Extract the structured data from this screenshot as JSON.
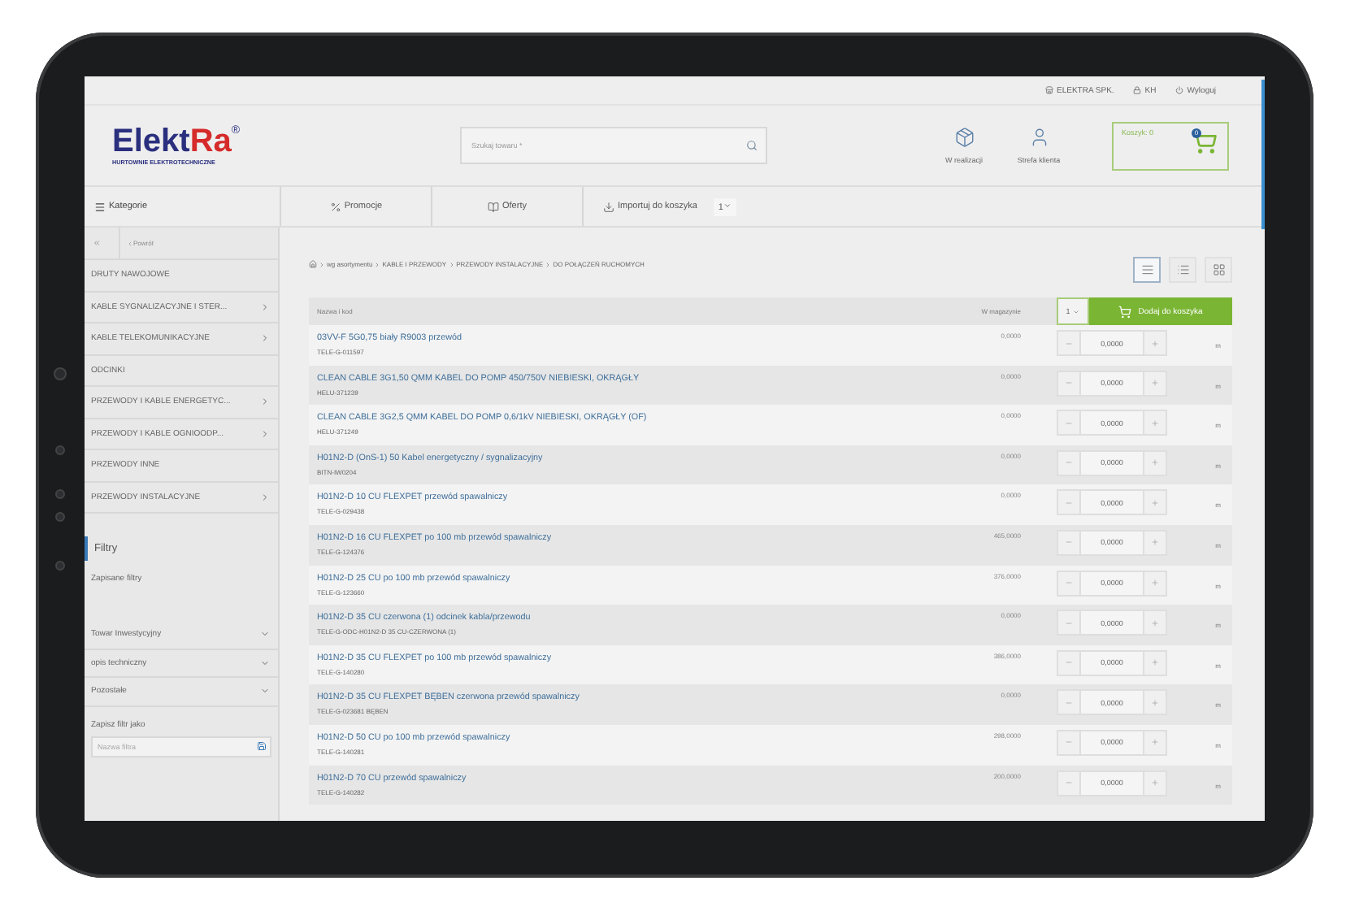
{
  "top_links": [
    {
      "kind": "store",
      "label": "ELEKTRA SPK."
    },
    {
      "kind": "lock",
      "label": "KH"
    },
    {
      "kind": "power",
      "label": "Wyloguj"
    }
  ],
  "logo": {
    "primary": "Elekt",
    "accent": "Ra",
    "mark": "®",
    "tagline": "HURTOWNIE ELEKTROTECHNICZNE"
  },
  "search": {
    "placeholder": "Szukaj towaru *"
  },
  "header_actions": [
    {
      "kind": "box",
      "label": "W realizacji"
    },
    {
      "kind": "user",
      "label": "Strefa klienta"
    }
  ],
  "cart": {
    "label": "Koszyk: 0",
    "count": "0"
  },
  "categories_button": {
    "label": "Kategorie"
  },
  "nav_tabs": [
    {
      "kind": "percent",
      "label": "Promocje"
    },
    {
      "kind": "book",
      "label": "Oferty"
    },
    {
      "kind": "import",
      "label": "Importuj do koszyka",
      "value": "1"
    }
  ],
  "sidebar": {
    "back_label": "Powrót",
    "items": [
      {
        "label": "DRUTY NAWOJOWE",
        "has_children": false
      },
      {
        "label": "KABLE SYGNALIZACYJNE I STER...",
        "has_children": true
      },
      {
        "label": "KABLE TELEKOMUNIKACYJNE",
        "has_children": true
      },
      {
        "label": "ODCINKI",
        "has_children": false
      },
      {
        "label": "PRZEWODY I KABLE ENERGETYC...",
        "has_children": true
      },
      {
        "label": "PRZEWODY I KABLE OGNIOODP...",
        "has_children": true
      },
      {
        "label": "PRZEWODY INNE",
        "has_children": false
      },
      {
        "label": "PRZEWODY INSTALACYJNE",
        "has_children": true
      }
    ],
    "filters": {
      "title": "Filtry",
      "saved_label": "Zapisane filtry",
      "dropdowns": [
        "Towar Inwestycyjny",
        "opis techniczny",
        "Pozostałe"
      ],
      "save_label": "Zapisz filtr jako",
      "name_placeholder": "Nazwa filtra"
    }
  },
  "breadcrumb": [
    "wg asortymentu",
    "KABLE I PRZEWODY",
    "PRZEWODY INSTALACYJNE",
    "DO POŁĄCZEŃ RUCHOMYCH"
  ],
  "view_modes": [
    {
      "kind": "list",
      "selected": true
    },
    {
      "kind": "compact",
      "selected": false
    },
    {
      "kind": "grid",
      "selected": false
    }
  ],
  "table": {
    "columns": [
      "Nazwa i kod",
      "W magazynie"
    ],
    "bulk_quantity": "1",
    "add_button": "Dodaj do koszyka",
    "rows": [
      {
        "name": "03VV-F 5G0,75 biały R9003 przewód",
        "code": "TELE-G-011597",
        "stock": "0,0000",
        "quantity": "0,0000",
        "unit": "m"
      },
      {
        "name": "CLEAN CABLE 3G1,50 QMM KABEL DO POMP 450/750V NIEBIESKI, OKRĄGŁY",
        "code": "HELU-371239",
        "stock": "0,0000",
        "quantity": "0,0000",
        "unit": "m"
      },
      {
        "name": "CLEAN CABLE 3G2,5 QMM KABEL DO POMP 0,6/1kV NIEBIESKI, OKRĄGŁY (OF)",
        "code": "HELU-371249",
        "stock": "0,0000",
        "quantity": "0,0000",
        "unit": "m"
      },
      {
        "name": "H01N2-D (OnS-1) 50 Kabel energetyczny / sygnalizacyjny",
        "code": "BITN-IW0204",
        "stock": "0,0000",
        "quantity": "0,0000",
        "unit": "m"
      },
      {
        "name": "H01N2-D 10 CU FLEXPET przewód spawalniczy",
        "code": "TELE-G-029438",
        "stock": "0,0000",
        "quantity": "0,0000",
        "unit": "m"
      },
      {
        "name": "H01N2-D 16 CU FLEXPET po 100 mb przewód spawalniczy",
        "code": "TELE-G-124376",
        "stock": "465,0000",
        "quantity": "0,0000",
        "unit": "m"
      },
      {
        "name": "H01N2-D 25 CU po 100 mb przewód spawalniczy",
        "code": "TELE-G-123660",
        "stock": "376,0000",
        "quantity": "0,0000",
        "unit": "m"
      },
      {
        "name": "H01N2-D 35 CU czerwona (1) odcinek kabla/przewodu",
        "code": "TELE-G-ODC-H01N2-D 35 CU-CZERWONA (1)",
        "stock": "0,0000",
        "quantity": "0,0000",
        "unit": "m"
      },
      {
        "name": "H01N2-D 35 CU FLEXPET po 100 mb przewód spawalniczy",
        "code": "TELE-G-140280",
        "stock": "386,0000",
        "quantity": "0,0000",
        "unit": "m"
      },
      {
        "name": "H01N2-D 35 CU FLEXPET BĘBEN czerwona przewód spawalniczy",
        "code": "TELE-G-023681 BĘBEN",
        "stock": "0,0000",
        "quantity": "0,0000",
        "unit": "m"
      },
      {
        "name": "H01N2-D 50 CU po 100 mb przewód spawalniczy",
        "code": "TELE-G-140281",
        "stock": "298,0000",
        "quantity": "0,0000",
        "unit": "m"
      },
      {
        "name": "H01N2-D 70 CU przewód spawalniczy",
        "code": "TELE-G-140282",
        "stock": "200,0000",
        "quantity": "0,0000",
        "unit": "m"
      }
    ]
  }
}
